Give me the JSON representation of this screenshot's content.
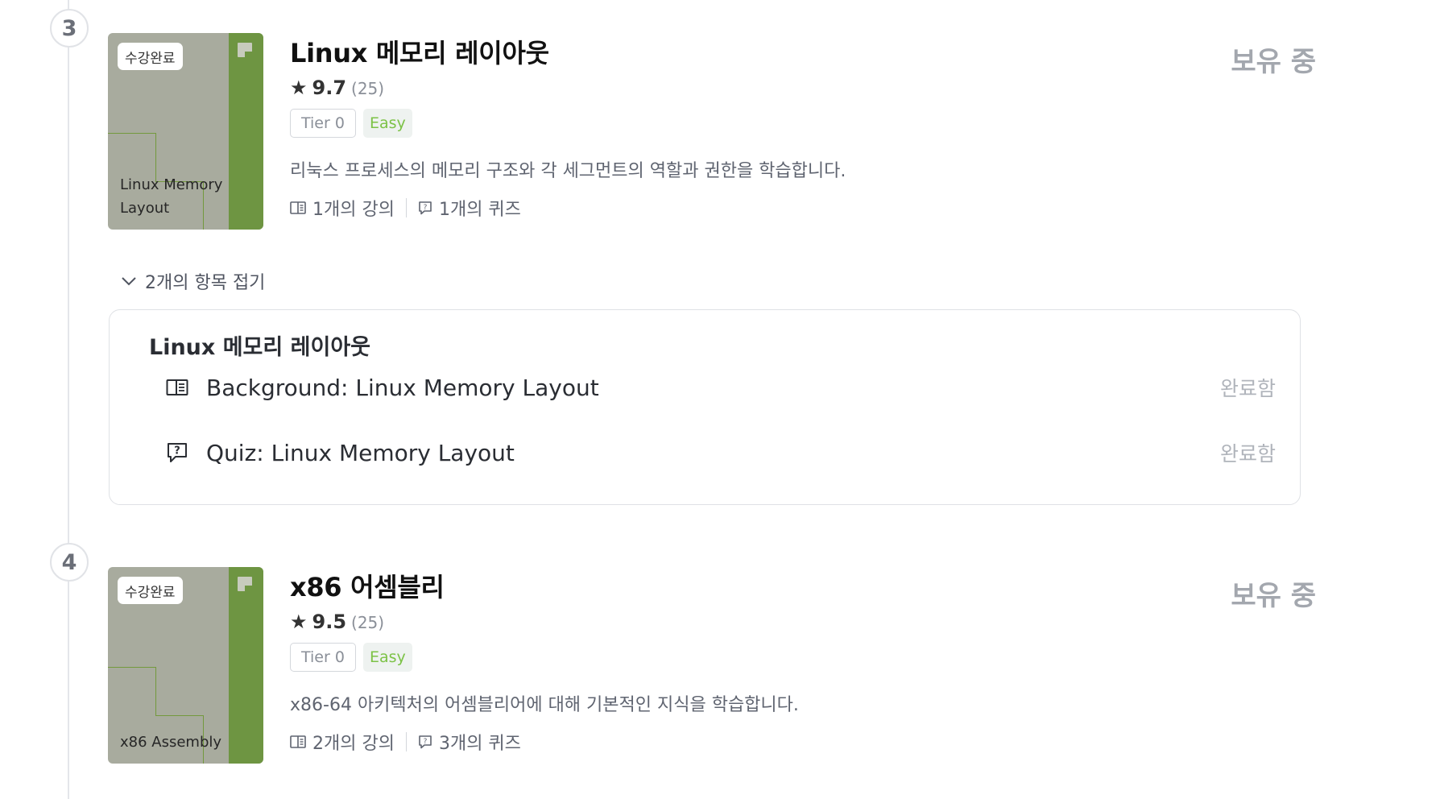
{
  "courses": [
    {
      "step": "3",
      "thumbnail_badge": "수강완료",
      "thumbnail_title": "Linux Memory Layout",
      "title": "Linux 메모리 레이아웃",
      "rating": "9.7",
      "rating_count": "(25)",
      "tier": "Tier 0",
      "difficulty": "Easy",
      "description": "리눅스 프로세스의 메모리 구조와 각 세그먼트의 역할과 권한을 학습합니다.",
      "lectures": "1개의 강의",
      "quizzes": "1개의 퀴즈",
      "status": "보유 중",
      "icons": {
        "star": "star-icon",
        "lecture": "lecture-icon",
        "quiz": "quiz-icon"
      }
    },
    {
      "step": "4",
      "thumbnail_badge": "수강완료",
      "thumbnail_title": "x86 Assembly",
      "title": "x86 어셈블리",
      "rating": "9.5",
      "rating_count": "(25)",
      "tier": "Tier 0",
      "difficulty": "Easy",
      "description": "x86-64 아키텍처의 어셈블리어에 대해 기본적인 지식을 학습합니다.",
      "lectures": "2개의 강의",
      "quizzes": "3개의 퀴즈",
      "status": "보유 중"
    }
  ],
  "collapse": {
    "label": "2개의 항목 접기",
    "icon": "chevron-down-icon"
  },
  "panel": {
    "title": "Linux 메모리 레이아웃",
    "items": [
      {
        "label": "Background: Linux Memory Layout",
        "status": "완료함",
        "icon": "lecture-icon"
      },
      {
        "label": "Quiz: Linux Memory Layout",
        "status": "완료함",
        "icon": "quiz-icon"
      }
    ]
  },
  "colors": {
    "accent_green": "#6e9542",
    "easy_green": "#7cc246",
    "muted": "#a3a7ae"
  }
}
